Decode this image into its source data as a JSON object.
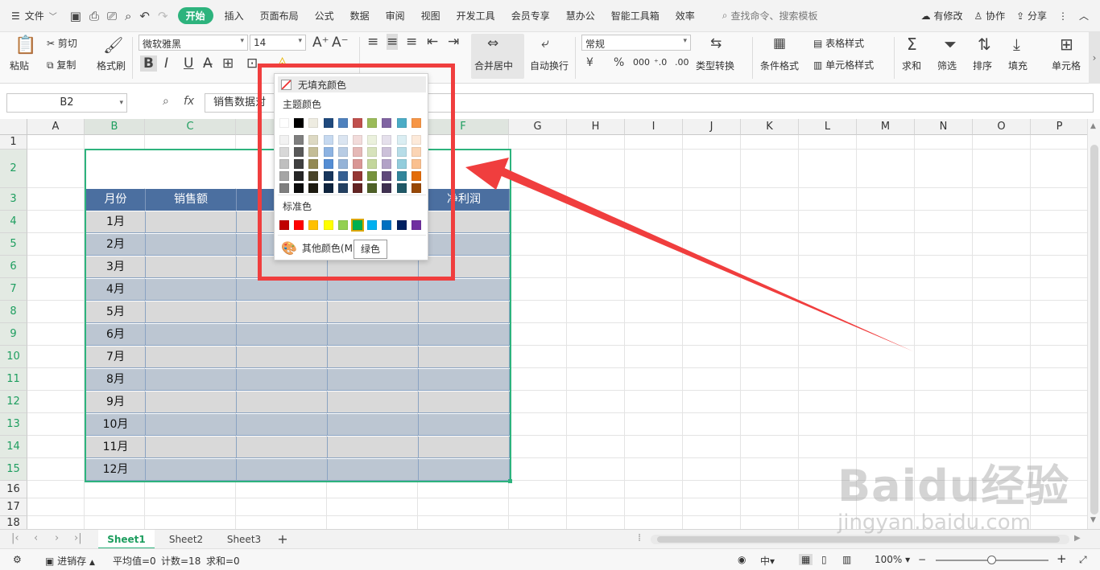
{
  "menubar": {
    "file": "文件",
    "tabs": [
      "开始",
      "插入",
      "页面布局",
      "公式",
      "数据",
      "审阅",
      "视图",
      "开发工具",
      "会员专享",
      "慧办公",
      "智能工具箱",
      "效率"
    ],
    "active_tab": "开始",
    "search_placeholder": "查找命令、搜索模板",
    "modified": "有修改",
    "collab": "协作",
    "share": "分享"
  },
  "ribbon": {
    "paste": "粘贴",
    "cut": "剪切",
    "copy": "复制",
    "format_painter": "格式刷",
    "font_name": "微软雅黑",
    "font_size": "14",
    "merge_center": "合并居中",
    "wrap_text": "自动换行",
    "number_format": "常规",
    "type_convert": "类型转换",
    "conditional_format": "条件格式",
    "table_style": "表格样式",
    "cell_style": "单元格样式",
    "sum": "求和",
    "filter": "筛选",
    "sort": "排序",
    "fill": "填充",
    "cell": "单元格"
  },
  "formula_bar": {
    "name_box": "B2",
    "fx": "fx",
    "content": "销售数据对"
  },
  "columns": [
    "A",
    "B",
    "C",
    "D",
    "E",
    "F",
    "G",
    "H",
    "I",
    "J",
    "K",
    "L",
    "M",
    "N",
    "O",
    "P"
  ],
  "rows": [
    "1",
    "2",
    "3",
    "4",
    "5",
    "6",
    "7",
    "8",
    "9",
    "10",
    "11",
    "12",
    "13",
    "14",
    "15",
    "16",
    "17",
    "18"
  ],
  "table": {
    "title": "销售",
    "headers": [
      "月份",
      "销售额",
      "销",
      "",
      "净利润"
    ],
    "months": [
      "1月",
      "2月",
      "3月",
      "4月",
      "5月",
      "6月",
      "7月",
      "8月",
      "9月",
      "10月",
      "11月",
      "12月"
    ]
  },
  "fill_dropdown": {
    "no_fill": "无填充颜色",
    "theme_label": "主题颜色",
    "theme_top": [
      "#ffffff",
      "#000000",
      "#eeece1",
      "#1f497d",
      "#4f81bd",
      "#c0504d",
      "#9bbb59",
      "#8064a2",
      "#4bacc6",
      "#f79646"
    ],
    "theme_shades": [
      [
        "#f2f2f2",
        "#7f7f7f",
        "#ddd9c3",
        "#c6d9f0",
        "#dbe5f1",
        "#f2dcdb",
        "#ebf1dd",
        "#e5e0ec",
        "#dbeef3",
        "#fdeada"
      ],
      [
        "#d8d8d8",
        "#595959",
        "#c4bd97",
        "#8db3e2",
        "#b8cce4",
        "#e5b9b7",
        "#d7e3bc",
        "#ccc1d9",
        "#b7dde8",
        "#fbd5b5"
      ],
      [
        "#bfbfbf",
        "#3f3f3f",
        "#938953",
        "#548dd4",
        "#95b3d7",
        "#d99694",
        "#c3d69b",
        "#b2a2c7",
        "#92cddc",
        "#fac08f"
      ],
      [
        "#a5a5a5",
        "#262626",
        "#494429",
        "#17365d",
        "#366092",
        "#953734",
        "#76923c",
        "#5f497a",
        "#31859b",
        "#e36c09"
      ],
      [
        "#7f7f7f",
        "#0c0c0c",
        "#1d1b10",
        "#0f243e",
        "#244061",
        "#632423",
        "#4f6128",
        "#3f3151",
        "#205867",
        "#974806"
      ]
    ],
    "standard_label": "标准色",
    "standard": [
      "#c00000",
      "#ff0000",
      "#ffc000",
      "#ffff00",
      "#92d050",
      "#00b050",
      "#00b0f0",
      "#0070c0",
      "#002060",
      "#7030a0"
    ],
    "highlighted_index": 5,
    "more_colors": "其他颜色(M)",
    "tooltip": "绿色"
  },
  "sheets": {
    "tabs": [
      "Sheet1",
      "Sheet2",
      "Sheet3"
    ],
    "active": "Sheet1",
    "add": "+"
  },
  "statusbar": {
    "save_status": "进销存",
    "average": "平均值=0",
    "count": "计数=18",
    "sum": "求和=0",
    "zoom": "100%"
  },
  "watermark": {
    "brand": "Baidu经验",
    "url": "jingyan.baidu.com"
  },
  "colors": {
    "accent_green": "#2db37d",
    "header_blue": "#4b6fa0",
    "annotation_red": "#f03e3e"
  }
}
